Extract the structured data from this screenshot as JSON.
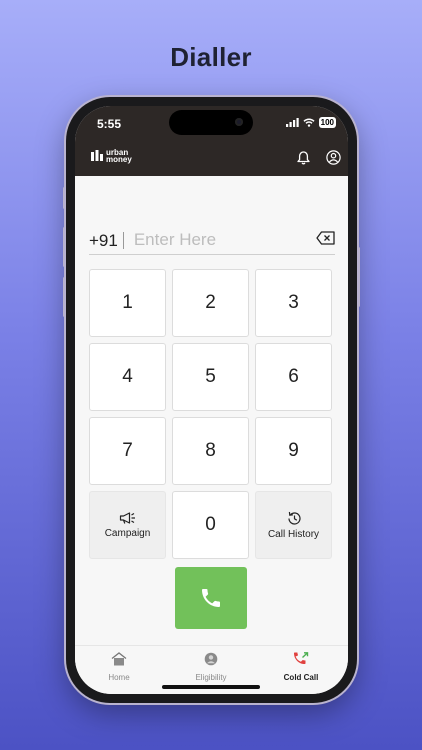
{
  "page_title": "Dialler",
  "status_bar": {
    "time": "5:55",
    "battery": "100"
  },
  "app": {
    "logo_line1": "urban",
    "logo_line2": "money"
  },
  "dialer": {
    "country_code": "+91",
    "input_placeholder": "Enter Here",
    "input_value": ""
  },
  "keys": [
    "1",
    "2",
    "3",
    "4",
    "5",
    "6",
    "7",
    "8",
    "9"
  ],
  "zero_key": "0",
  "campaign_label": "Campaign",
  "call_history_label": "Call History",
  "nav": {
    "home": "Home",
    "eligibility": "Eligibility",
    "cold_call": "Cold Call"
  },
  "colors": {
    "call_button": "#72c15a",
    "topbar": "#2d2826",
    "background_top": "#a7aef9",
    "background_bottom": "#4c52c4"
  }
}
